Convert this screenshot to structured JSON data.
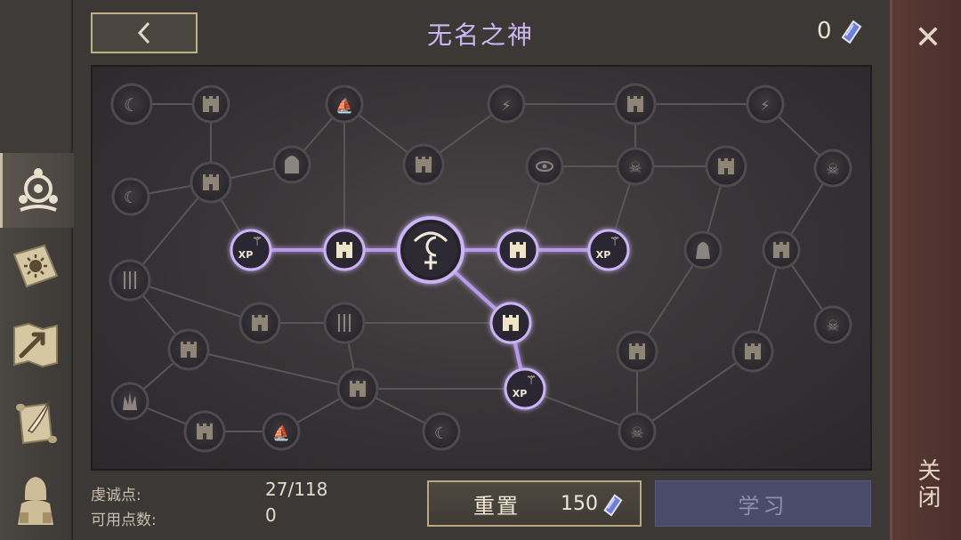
{
  "header": {
    "title": "无名之神",
    "currency_count": "0",
    "back_icon": "chevron-left-icon",
    "currency_icon": "blue-crystal-icon"
  },
  "left_tabs": [
    {
      "name": "tab-followers",
      "icon": "trinity-symbol-icon",
      "active": true
    },
    {
      "name": "tab-spellbook",
      "icon": "sun-book-icon",
      "active": false
    },
    {
      "name": "tab-map",
      "icon": "map-arrow-icon",
      "active": false
    },
    {
      "name": "tab-quests",
      "icon": "scroll-quill-icon",
      "active": false
    },
    {
      "name": "tab-character",
      "icon": "hooded-figure-icon",
      "active": false
    }
  ],
  "right_rail": {
    "close_symbol": "✕",
    "close_label": "关闭"
  },
  "stats": {
    "devotion_label": "虔诚点:",
    "devotion_value": "27/118",
    "available_label": "可用点数:",
    "available_value": "0"
  },
  "buttons": {
    "reset_label": "重置",
    "reset_cost": "150",
    "learn_label": "学习"
  },
  "xp_badge": "XP",
  "colors": {
    "accent_purple": "#c9b2f0",
    "active_line": "#b89be8",
    "node_gold": "#cfc2a8",
    "learn_disabled": "#4a4a6a"
  }
}
